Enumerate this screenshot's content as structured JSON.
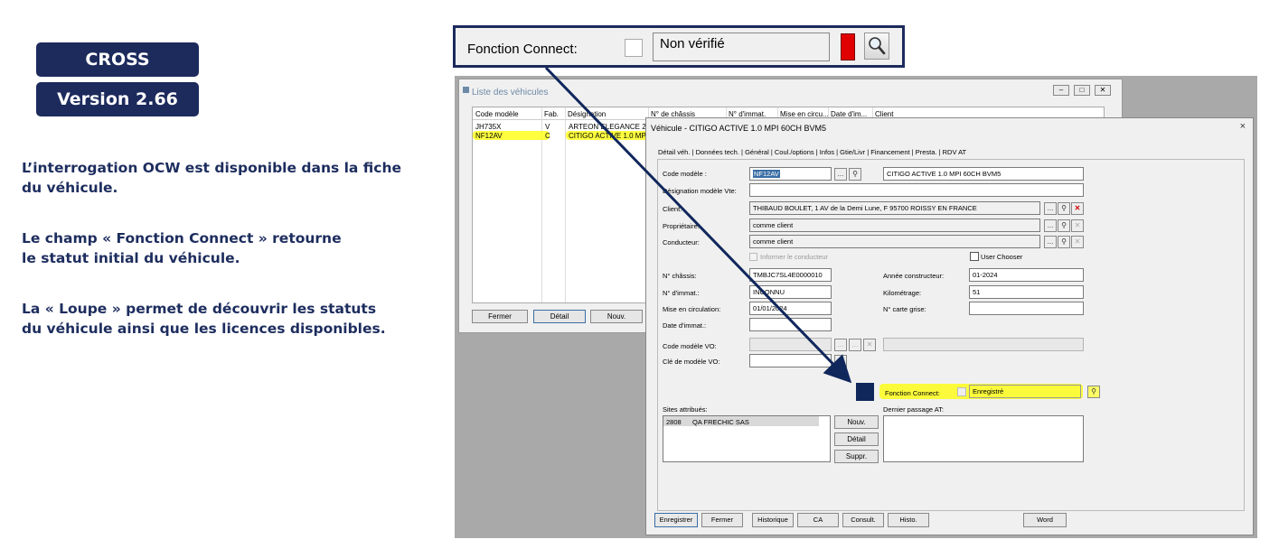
{
  "left": {
    "badge1": "CROSS",
    "badge2": "Version 2.66",
    "p1_l1": "L’interrogation OCW est disponible dans la fiche",
    "p1_l2": "du véhicule.",
    "p2_l1": "Le champ « Fonction Connect » retourne",
    "p2_l2": "le statut initial du véhicule.",
    "p3_l1": "La « Loupe » permet de découvrir les statuts",
    "p3_l2": "du véhicule ainsi que les licences disponibles."
  },
  "callout": {
    "label": "Fonction Connect:",
    "value": "Non vérifié",
    "status_color": "#e00000"
  },
  "list_window": {
    "title": "Liste des véhicules",
    "headers": [
      "Code modèle",
      "Fab.",
      "Désignation",
      "N° de châssis",
      "N° d'immat.",
      "Mise en circu...",
      "Date d'im...",
      "Client"
    ],
    "rows": [
      [
        "JH735X",
        "V",
        "ARTEON ELEGANCE 2.0 ..."
      ],
      [
        "NF12AV",
        "C",
        "CITIGO ACTIVE 1.0 MPI ..."
      ]
    ],
    "buttons": [
      "Fermer",
      "Détail",
      "Nouv."
    ]
  },
  "vehicle_window": {
    "title": "Véhicule - CITIGO ACTIVE 1.0 MPI 60CH BVM5",
    "close": "×",
    "tabs": [
      "Détail véh.",
      "Données tech.",
      "Général",
      "Coul./options",
      "Infos",
      "Gtie/Livr",
      "Financement",
      "Presta.",
      "RDV AT"
    ],
    "labels": {
      "code_modele": "Code modèle :",
      "designation_vte": "Désignation modèle Vte:",
      "client": "Client:",
      "proprietaire": "Propriétaire:",
      "conducteur": "Conducteur:",
      "informer": "Informer le conducteur",
      "user_chooser": "User Chooser",
      "chassis": "N° châssis:",
      "immat": "N° d'immat.:",
      "mise_circ": "Mise en circulation:",
      "date_immat": "Date d'immat.:",
      "code_vo": "Code modèle VO:",
      "cle_vo": "Clé de modèle VO:",
      "annee": "Année constructeur:",
      "km": "Kilométrage:",
      "carte_grise": "N° carte grise:",
      "fonction_connect": "Fonction Connect:",
      "sites": "Sites attribués:",
      "dernier_passage": "Dernier passage AT:"
    },
    "values": {
      "code_modele": "NF12AV",
      "designation": "CITIGO ACTIVE 1.0 MPI 60CH BVM5",
      "designation_vte": "",
      "client": "THIBAUD BOULET, 1 AV de la Demi Lune, F 95700 ROISSY EN FRANCE",
      "proprietaire": "comme client",
      "conducteur": "comme client",
      "chassis": "TMBJC7SL4E0000010",
      "immat": "INCONNU",
      "mise_circ": "01/01/2024",
      "date_immat": "",
      "annee": "01-2024",
      "km": "51",
      "carte_grise": "",
      "fonction_connect": "Enregistré",
      "site_code": "2808",
      "site_name": "QA FRECHIC SAS"
    },
    "site_buttons": [
      "Nouv.",
      "Détail",
      "Suppr."
    ],
    "bottom_buttons": [
      "Enregistrer",
      "Fermer",
      "Historique",
      "CA",
      "Consult.",
      "Histo.",
      "Word"
    ]
  },
  "colors": {
    "navy": "#1c2a5c",
    "highlight": "#ffff00",
    "red": "#e00000"
  }
}
